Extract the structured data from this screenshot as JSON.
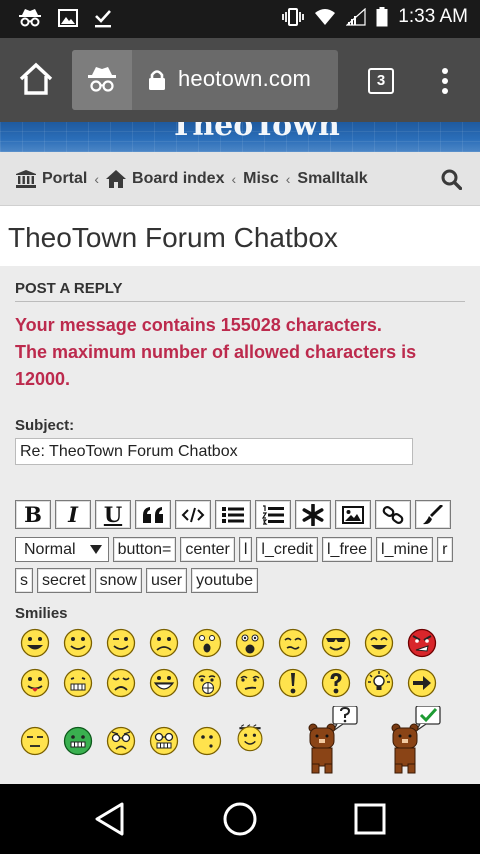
{
  "status_bar": {
    "time": "1:33 AM"
  },
  "browser": {
    "url": "heotown.com",
    "tab_count": "3"
  },
  "banner": {
    "partial_text": "TheoTown"
  },
  "breadcrumb": {
    "items": [
      {
        "label": "Portal",
        "icon": "building-icon"
      },
      {
        "label": "Board index",
        "icon": "home-icon"
      },
      {
        "label": "Misc"
      },
      {
        "label": "Smalltalk"
      }
    ],
    "separator": "‹"
  },
  "page": {
    "title": "TheoTown Forum Chatbox",
    "section_title": "POST A REPLY",
    "error_lines": [
      "Your message contains 155028 characters.",
      "The maximum number of allowed characters is 12000."
    ],
    "subject_label": "Subject:",
    "subject_value": "Re: TheoTown Forum Chatbox",
    "smilies_label": "Smilies"
  },
  "toolbar": {
    "format_buttons": [
      "B",
      "I",
      "U"
    ],
    "icon_buttons": [
      "quote-icon",
      "code-icon",
      "list-icon",
      "numbered-list-icon",
      "asterisk-icon",
      "image-icon",
      "link-icon",
      "color-icon"
    ],
    "font_size_value": "Normal",
    "bbcode_buttons": [
      "button=",
      "center",
      "l",
      "l_credit",
      "l_free",
      "l_mine",
      "r",
      "s",
      "secret",
      "snow",
      "user",
      "youtube"
    ]
  },
  "colors": {
    "error": "#bc2a4d",
    "status_bar": "#1a1a1a",
    "chrome": "#4a4a4a",
    "panel": "#ececec",
    "smiley_yellow": "#ffe34d"
  }
}
